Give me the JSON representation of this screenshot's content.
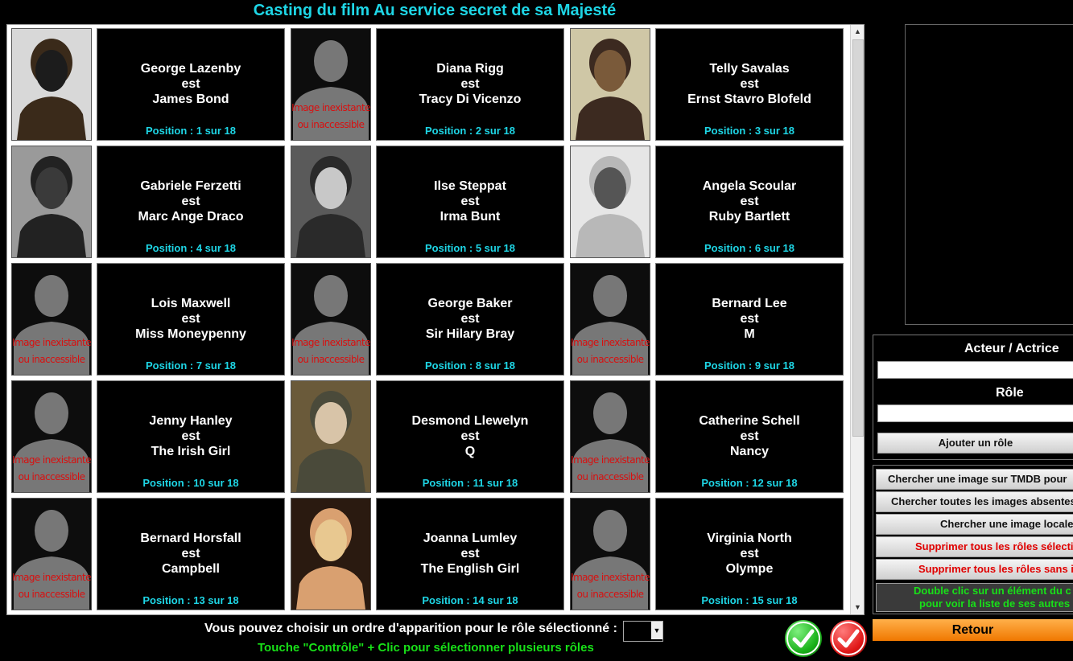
{
  "window": {
    "title": "Casting du film Au service secret de sa Majesté"
  },
  "cast": [
    {
      "actor": "George Lazenby",
      "connector": "est",
      "role": "James Bond",
      "position": "Position : 1 sur 18",
      "photo": "photo-lazenby"
    },
    {
      "actor": "Diana Rigg",
      "connector": "est",
      "role": "Tracy Di Vicenzo",
      "position": "Position : 2 sur 18",
      "photo": "placeholder"
    },
    {
      "actor": "Telly Savalas",
      "connector": "est",
      "role": "Ernst Stavro Blofeld",
      "position": "Position : 3 sur 18",
      "photo": "photo-savalas"
    },
    {
      "actor": "Gabriele Ferzetti",
      "connector": "est",
      "role": "Marc Ange Draco",
      "position": "Position : 4 sur 18",
      "photo": "photo-ferzetti"
    },
    {
      "actor": "Ilse Steppat",
      "connector": "est",
      "role": "Irma Bunt",
      "position": "Position : 5 sur 18",
      "photo": "photo-steppat"
    },
    {
      "actor": "Angela Scoular",
      "connector": "est",
      "role": "Ruby Bartlett",
      "position": "Position : 6 sur 18",
      "photo": "photo-scoular"
    },
    {
      "actor": "Lois Maxwell",
      "connector": "est",
      "role": "Miss Moneypenny",
      "position": "Position : 7 sur 18",
      "photo": "placeholder"
    },
    {
      "actor": "George Baker",
      "connector": "est",
      "role": "Sir Hilary Bray",
      "position": "Position : 8 sur 18",
      "photo": "placeholder"
    },
    {
      "actor": "Bernard Lee",
      "connector": "est",
      "role": "M",
      "position": "Position : 9 sur 18",
      "photo": "placeholder"
    },
    {
      "actor": "Jenny Hanley",
      "connector": "est",
      "role": "The Irish Girl",
      "position": "Position : 10 sur 18",
      "photo": "placeholder"
    },
    {
      "actor": "Desmond Llewelyn",
      "connector": "est",
      "role": "Q",
      "position": "Position : 11 sur 18",
      "photo": "photo-llewelyn"
    },
    {
      "actor": "Catherine Schell",
      "connector": "est",
      "role": "Nancy",
      "position": "Position : 12 sur 18",
      "photo": "placeholder"
    },
    {
      "actor": "Bernard Horsfall",
      "connector": "est",
      "role": "Campbell",
      "position": "Position : 13 sur 18",
      "photo": "placeholder"
    },
    {
      "actor": "Joanna Lumley",
      "connector": "est",
      "role": "The English Girl",
      "position": "Position : 14 sur 18",
      "photo": "photo-lumley"
    },
    {
      "actor": "Virginia North",
      "connector": "est",
      "role": "Olympe",
      "position": "Position : 15 sur 18",
      "photo": "placeholder"
    }
  ],
  "placeholder": {
    "line1": "Image inexistante",
    "line2": "ou inaccessible"
  },
  "form": {
    "actor_label": "Acteur / Actrice",
    "actor_value": "",
    "role_label": "Rôle",
    "role_value": "",
    "add_button": "Ajouter un rôle"
  },
  "tools": {
    "tmdb": "Chercher une image sur TMDB pour",
    "all_missing": "Chercher toutes les images absentes",
    "local": "Chercher une image locale",
    "delete_selected": "Supprimer tous les rôles sélecti",
    "delete_without": "Supprimer tous les rôles sans i",
    "hint_line1": "Double clic sur un élément du c",
    "hint_line2": "pour voir la liste de ses autres"
  },
  "footer": {
    "order_label": "Vous pouvez choisir un ordre d'apparition pour le rôle sélectionné :",
    "order_value": "",
    "multi_hint": "Touche \"Contrôle\" + Clic pour sélectionner plusieurs rôles",
    "back_button": "Retour"
  },
  "colors": {
    "accent_cyan": "#1ed6e6",
    "ok_green": "#18c018",
    "cancel_red": "#e01818",
    "back_orange": "#f59a2a"
  }
}
